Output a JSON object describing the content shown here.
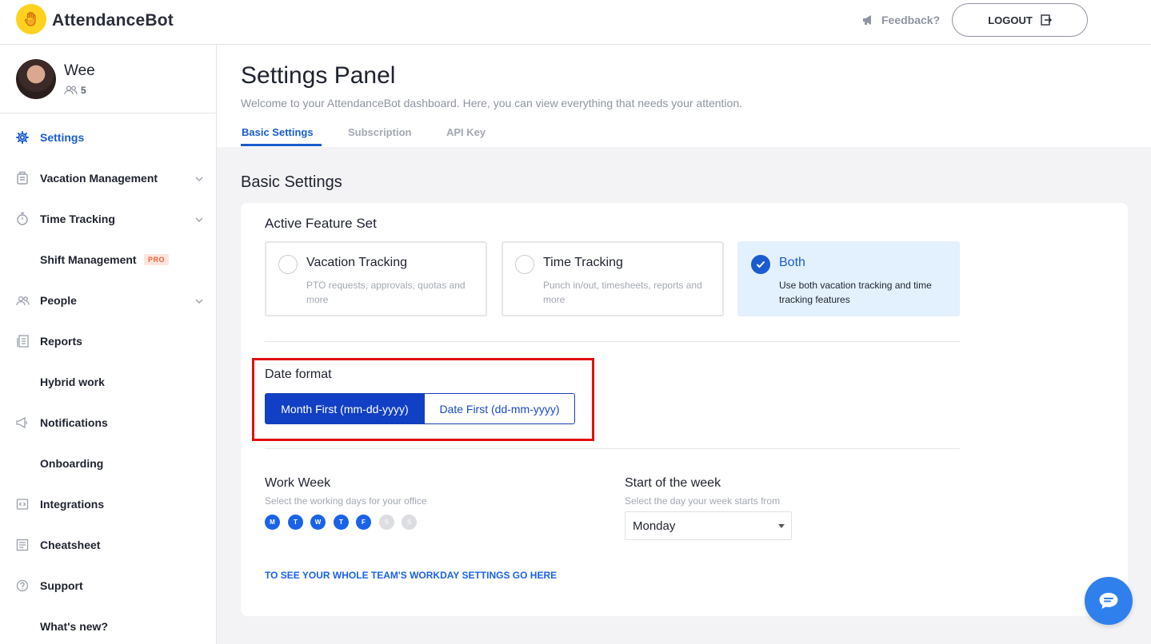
{
  "app": {
    "brand": "AttendanceBot"
  },
  "topbar": {
    "feedback_label": "Feedback?",
    "logout_label": "LOGOUT"
  },
  "profile": {
    "name": "Wee",
    "member_count": "5"
  },
  "sidebar": {
    "items": [
      {
        "label": "Settings",
        "icon": "gear-icon",
        "active": true
      },
      {
        "label": "Vacation Management",
        "icon": "luggage-icon",
        "expandable": true
      },
      {
        "label": "Time Tracking",
        "icon": "stopwatch-icon",
        "expandable": true
      },
      {
        "label": "Shift Management",
        "badge": "PRO"
      },
      {
        "label": "People",
        "icon": "people-icon",
        "expandable": true
      },
      {
        "label": "Reports",
        "icon": "report-icon"
      },
      {
        "label": "Hybrid work"
      },
      {
        "label": "Notifications",
        "icon": "megaphone-icon"
      },
      {
        "label": "Onboarding"
      },
      {
        "label": "Integrations",
        "icon": "integrations-icon"
      },
      {
        "label": "Cheatsheet",
        "icon": "cheatsheet-icon"
      },
      {
        "label": "Support",
        "icon": "help-icon"
      },
      {
        "label": "What's new?"
      }
    ]
  },
  "header": {
    "title": "Settings Panel",
    "subtitle": "Welcome to your AttendanceBot dashboard. Here, you can view everything that needs your attention.",
    "tabs": [
      {
        "label": "Basic Settings",
        "active": true
      },
      {
        "label": "Subscription"
      },
      {
        "label": "API Key"
      }
    ]
  },
  "basic_settings": {
    "section_title": "Basic Settings",
    "active_feature_set": {
      "title": "Active Feature Set",
      "options": [
        {
          "title": "Vacation Tracking",
          "description": "PTO requests, approvals, quotas and more",
          "selected": false
        },
        {
          "title": "Time Tracking",
          "description": "Punch in/out, timesheets, reports and more",
          "selected": false
        },
        {
          "title": "Both",
          "description": "Use both vacation tracking and time tracking features",
          "selected": true
        }
      ]
    },
    "date_format": {
      "title": "Date format",
      "options": [
        {
          "label": "Month First (mm-dd-yyyy)",
          "selected": true
        },
        {
          "label": "Date First (dd-mm-yyyy)",
          "selected": false
        }
      ]
    },
    "work_week": {
      "title": "Work Week",
      "subtitle": "Select the working days for your office",
      "days": [
        {
          "letter": "M",
          "on": true
        },
        {
          "letter": "T",
          "on": true
        },
        {
          "letter": "W",
          "on": true
        },
        {
          "letter": "T",
          "on": true
        },
        {
          "letter": "F",
          "on": true
        },
        {
          "letter": "S",
          "on": false
        },
        {
          "letter": "S",
          "on": false
        }
      ]
    },
    "start_of_week": {
      "title": "Start of the week",
      "subtitle": "Select the day your week starts from",
      "selected": "Monday"
    },
    "team_link": "TO SEE YOUR WHOLE TEAM'S WORKDAY SETTINGS GO HERE"
  },
  "colors": {
    "accent": "#1a5ccf",
    "highlight_border": "#e01010",
    "logo": "#ffd21f"
  }
}
